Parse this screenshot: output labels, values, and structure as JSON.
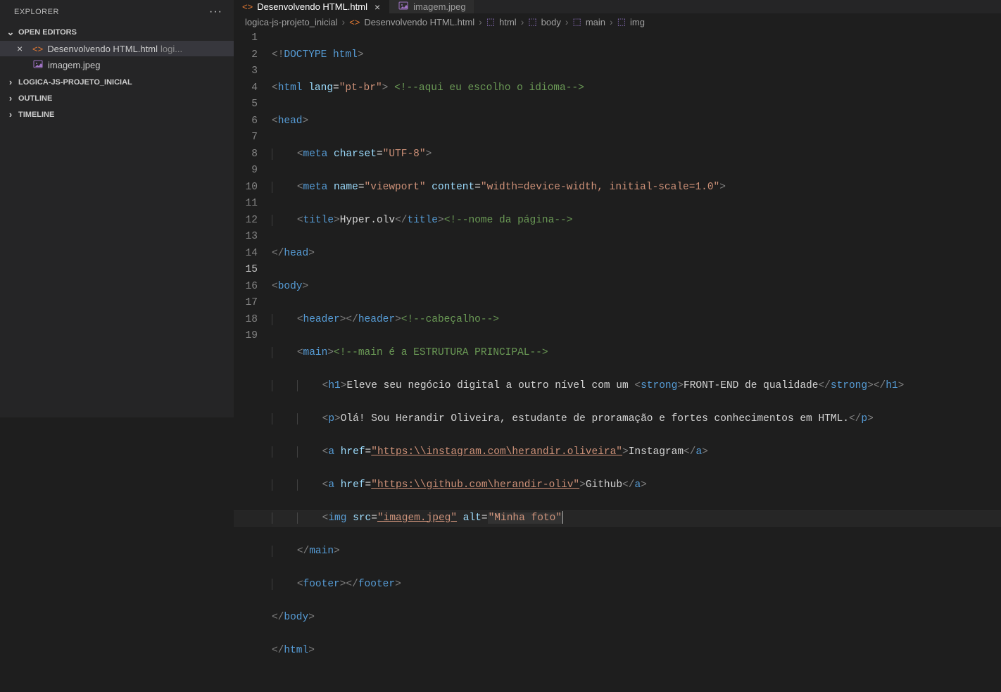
{
  "sidebar": {
    "title": "EXPLORER",
    "sections": {
      "openEditors": "OPEN EDITORS",
      "project": "LOGICA-JS-PROJETO_INICIAL",
      "outline": "OUTLINE",
      "timeline": "TIMELINE"
    },
    "openFiles": [
      {
        "name": "Desenvolvendo HTML.html",
        "path": "logi..."
      },
      {
        "name": "imagem.jpeg"
      }
    ]
  },
  "tabs": [
    {
      "label": "Desenvolvendo HTML.html",
      "active": true
    },
    {
      "label": "imagem.jpeg",
      "active": false
    }
  ],
  "breadcrumbs": [
    {
      "label": "logica-js-projeto_inicial"
    },
    {
      "label": "Desenvolvendo HTML.html",
      "icon": "html"
    },
    {
      "label": "html",
      "icon": "cube"
    },
    {
      "label": "body",
      "icon": "cube"
    },
    {
      "label": "main",
      "icon": "cube"
    },
    {
      "label": "img",
      "icon": "cube"
    }
  ],
  "code": {
    "lineCount": 19,
    "activeLine": 15,
    "l1": {
      "doctype": "DOCTYPE",
      "html": "html"
    },
    "l2": {
      "tag": "html",
      "attr": "lang",
      "val": "\"pt-br\"",
      "cmt": "<!--aqui eu escolho o idioma-->"
    },
    "l3": {
      "tag": "head"
    },
    "l4": {
      "tag": "meta",
      "attr": "charset",
      "val": "\"UTF-8\""
    },
    "l5": {
      "tag": "meta",
      "a1": "name",
      "v1": "\"viewport\"",
      "a2": "content",
      "v2": "\"width=device-width, initial-scale=1.0\""
    },
    "l6": {
      "tag": "title",
      "txt": "Hyper.olv",
      "cmt": "<!--nome da página-->"
    },
    "l7": {
      "tag": "head"
    },
    "l8": {
      "tag": "body"
    },
    "l9": {
      "tag": "header",
      "cmt": "<!--cabeçalho-->"
    },
    "l10": {
      "tag": "main",
      "cmt": "<!--main é a ESTRUTURA PRINCIPAL-->"
    },
    "l11": {
      "tag": "h1",
      "t1": "Eleve seu negócio digital a outro nível com um ",
      "strong": "strong",
      "t2": "FRONT-END de qualidade"
    },
    "l12": {
      "tag": "p",
      "txt": "Olá! Sou Herandir Oliveira, estudante de proramação e fortes conhecimentos em HTML."
    },
    "l13": {
      "tag": "a",
      "attr": "href",
      "val": "\"https:\\\\instagram.com\\herandir.oliveira\"",
      "txt": "Instagram"
    },
    "l14": {
      "tag": "a",
      "attr": "href",
      "val": "\"https:\\\\github.com\\herandir-oliv\"",
      "txt": "Github"
    },
    "l15": {
      "tag": "img",
      "a1": "src",
      "v1": "\"imagem.jpeg\"",
      "a2": "alt",
      "v2": "\"Minha foto\""
    },
    "l16": {
      "tag": "main"
    },
    "l17": {
      "tag": "footer"
    },
    "l18": {
      "tag": "body"
    },
    "l19": {
      "tag": "html"
    }
  }
}
